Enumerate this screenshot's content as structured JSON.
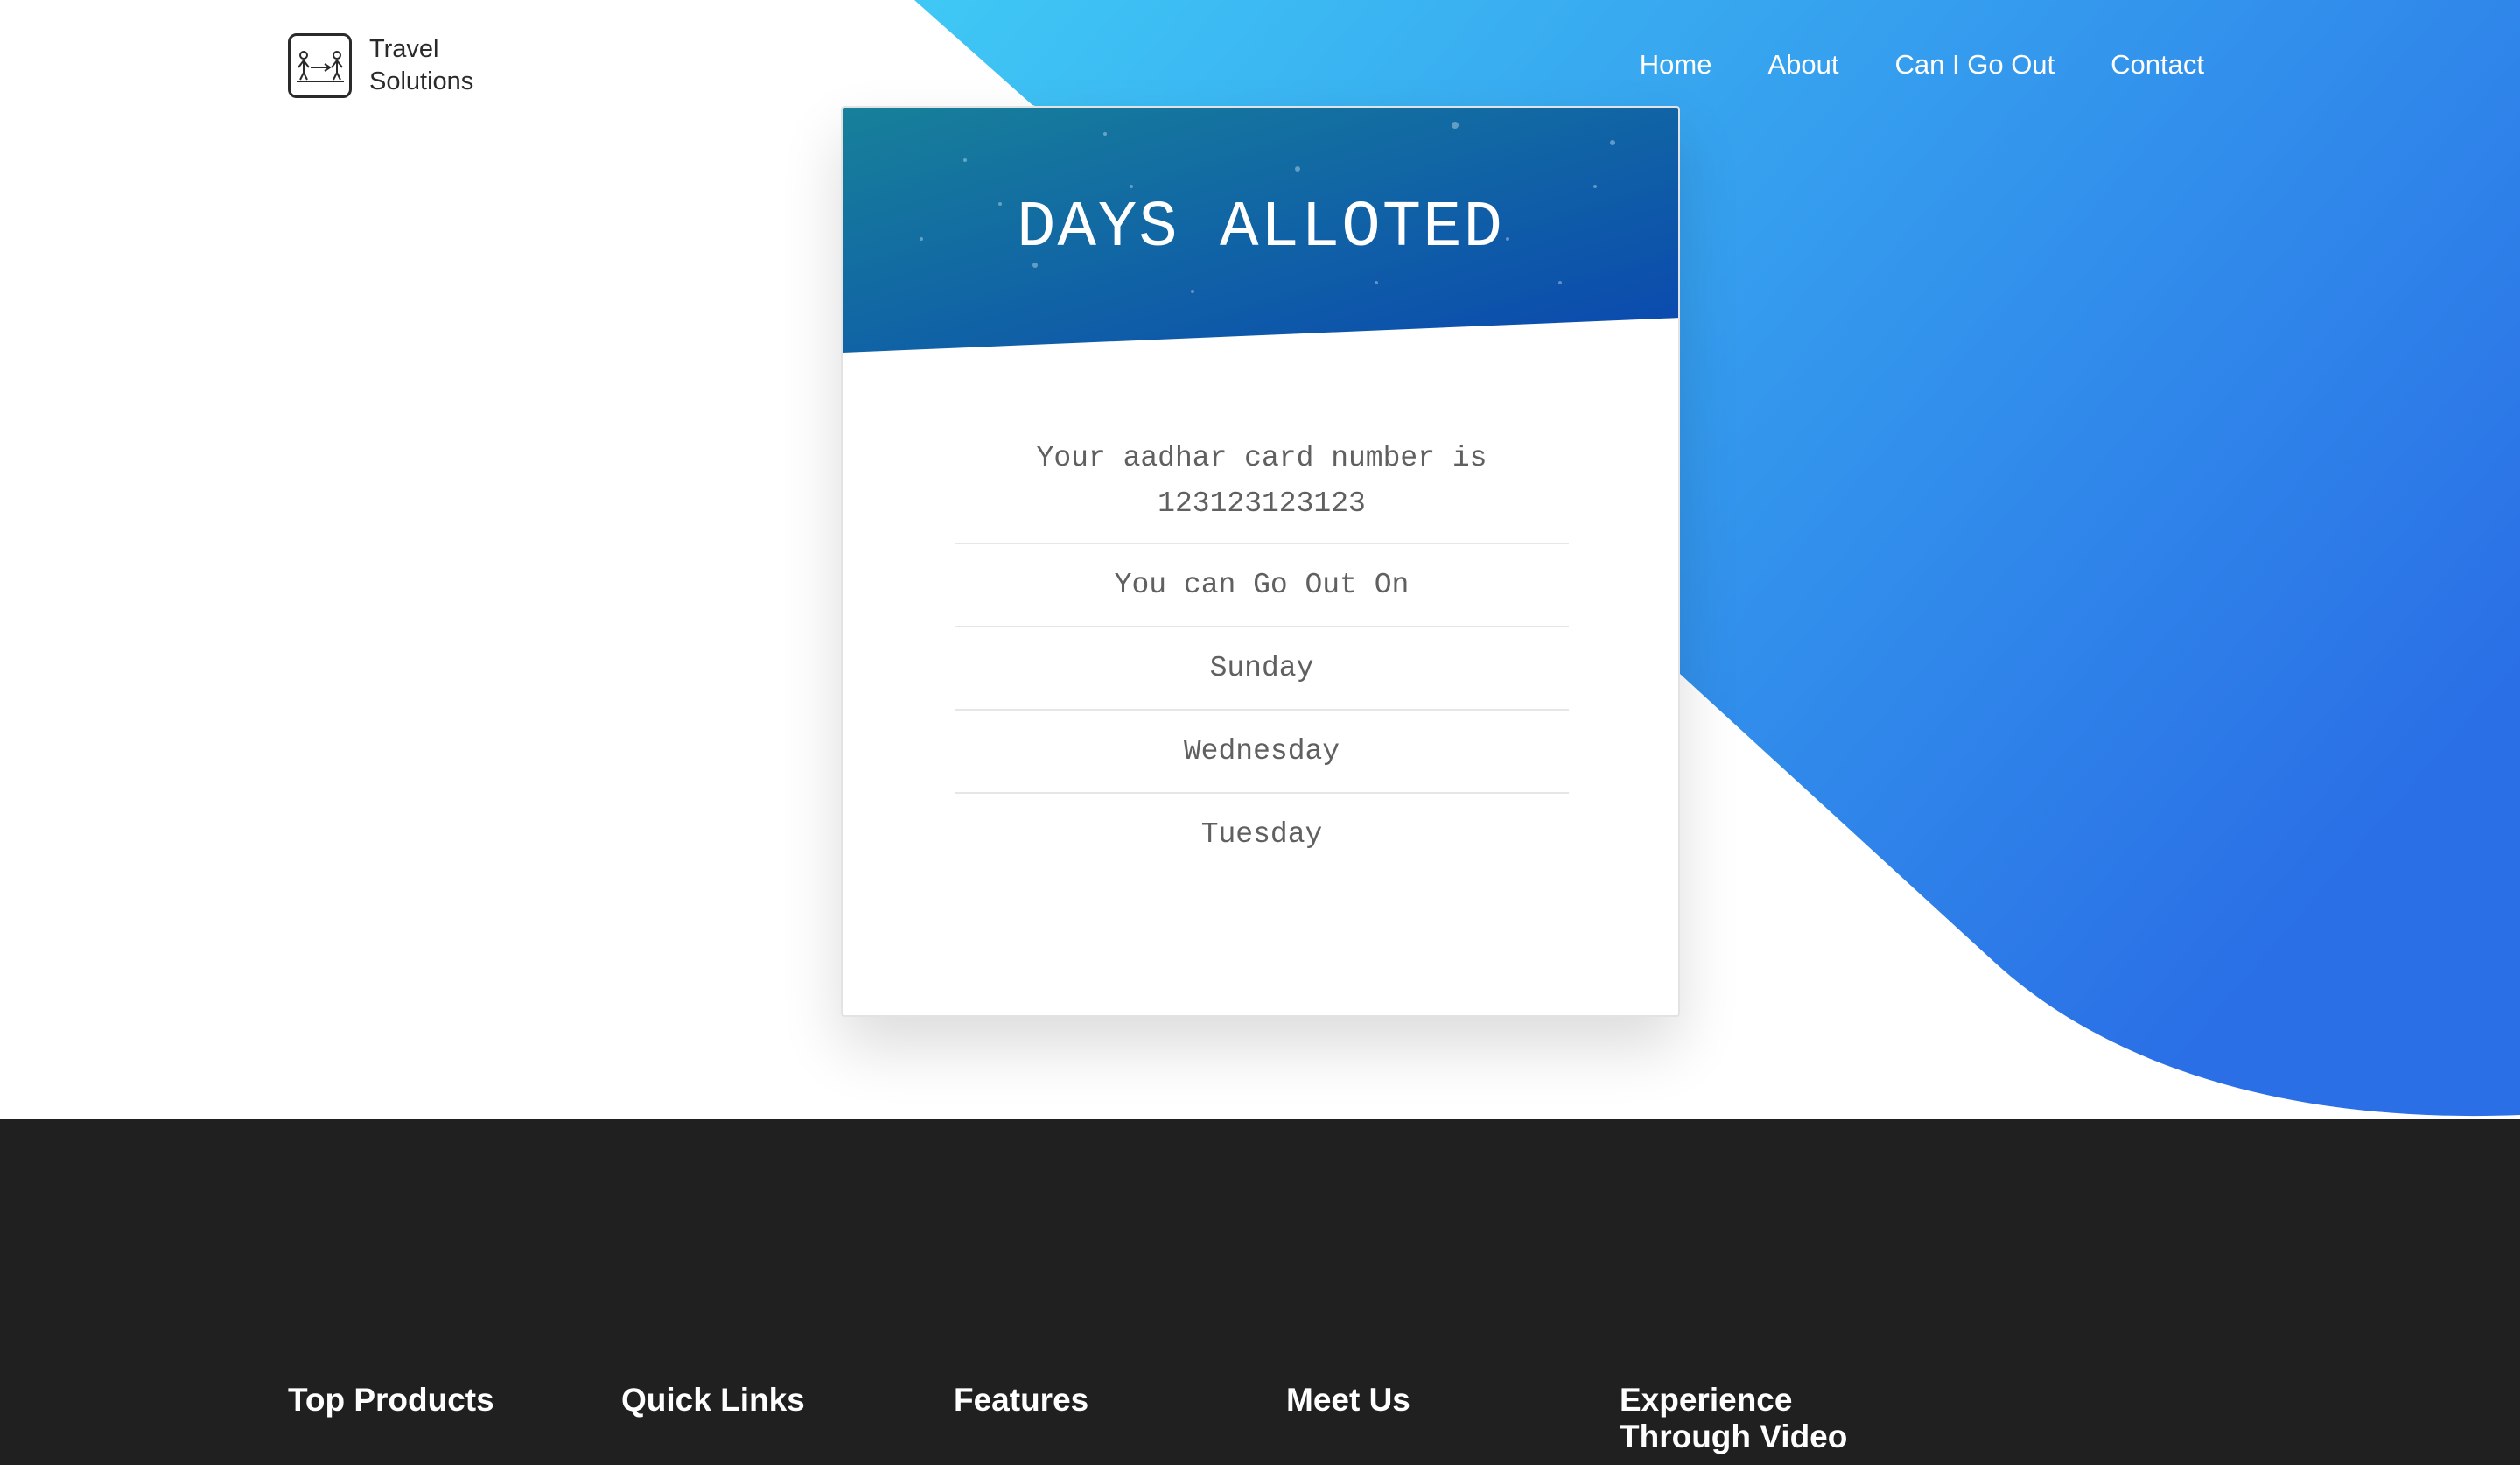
{
  "brand": {
    "line1": "Travel",
    "line2": "Solutions",
    "icon": "travelers-icon"
  },
  "nav": {
    "home": "Home",
    "about": "About",
    "can_i_go_out": "Can I Go Out",
    "contact": "Contact"
  },
  "card": {
    "title": "DAYS ALLOTED",
    "aadhar_text": "Your aadhar card number is 123123123123",
    "go_out_heading": "You can Go Out On",
    "days": [
      "Sunday",
      "Wednesday",
      "Tuesday"
    ]
  },
  "footer": {
    "top_products": "Top Products",
    "quick_links": "Quick Links",
    "features": "Features",
    "meet_us": "Meet Us",
    "experience_video": "Experience Through Video"
  },
  "colors": {
    "wave_light": "#3fc8f5",
    "wave_dark": "#2a6fe6",
    "header_teal": "#17809a",
    "header_blue": "#0a47b0",
    "footer_bg": "#202020"
  }
}
